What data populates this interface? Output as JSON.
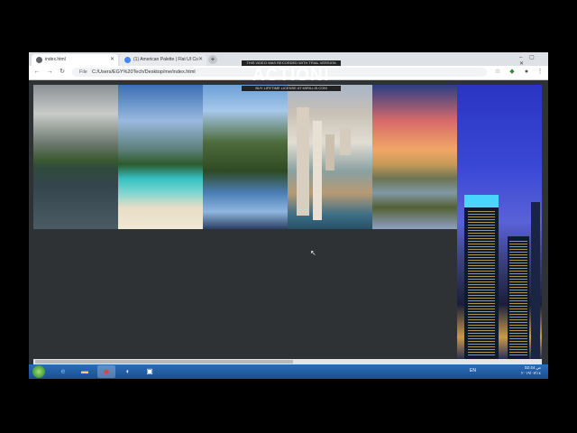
{
  "browser": {
    "tabs": [
      {
        "label": "index.html",
        "favicon_color": "#5f6368"
      },
      {
        "label": "(1) American Palette | Flat UI Co",
        "favicon_color": "#4285f4"
      }
    ],
    "new_tab_symbol": "+",
    "window_buttons": "– ▢ ✕",
    "address": {
      "scheme_label": "File",
      "url": "C:/Users/EGY%20Tech/Desktop/me/index.html"
    },
    "icons": [
      "back-icon",
      "forward-icon",
      "reload-icon",
      "star-icon",
      "extension-icon",
      "profile-icon",
      "menu-icon"
    ]
  },
  "watermark": {
    "top": "THIS VIDEO WAS RECORDED WITH TRIAL VERSION",
    "brand": "ACTION!",
    "bottom": "BUY LIFETIME LICENSE AT MIRILLIS.COM"
  },
  "page": {
    "photos": [
      {
        "name": "mountain-lake"
      },
      {
        "name": "tropical-beach"
      },
      {
        "name": "forest-lake-reflection"
      },
      {
        "name": "coastal-city"
      },
      {
        "name": "sunset-marsh"
      },
      {
        "name": "night-skyscrapers"
      }
    ],
    "horizontal_scroll_fraction": 0.51
  },
  "taskbar": {
    "apps": [
      "start-icon",
      "ie-icon",
      "explorer-icon",
      "chrome-icon",
      "app-icon",
      "media-icon"
    ],
    "language": "EN",
    "clock_time": "02:44 ص",
    "clock_date": "٢٠١٩/٠٧/١٤"
  }
}
